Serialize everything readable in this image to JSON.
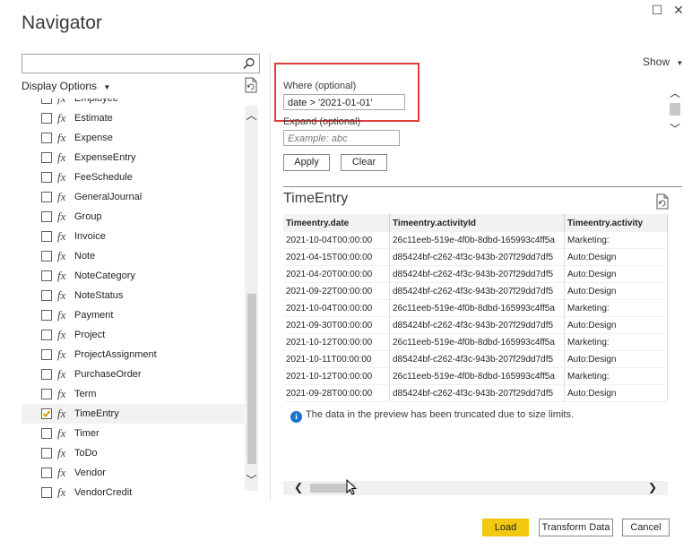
{
  "window": {
    "title": "Navigator",
    "restore_glyph": "☐",
    "close_glyph": "✕"
  },
  "left": {
    "search": {
      "value": "",
      "placeholder": "",
      "icon": "search-icon"
    },
    "display_options_label": "Display Options",
    "items": [
      {
        "label": "Employee",
        "checked": false,
        "selected": false
      },
      {
        "label": "Estimate",
        "checked": false,
        "selected": false
      },
      {
        "label": "Expense",
        "checked": false,
        "selected": false
      },
      {
        "label": "ExpenseEntry",
        "checked": false,
        "selected": false
      },
      {
        "label": "FeeSchedule",
        "checked": false,
        "selected": false
      },
      {
        "label": "GeneralJournal",
        "checked": false,
        "selected": false
      },
      {
        "label": "Group",
        "checked": false,
        "selected": false
      },
      {
        "label": "Invoice",
        "checked": false,
        "selected": false
      },
      {
        "label": "Note",
        "checked": false,
        "selected": false
      },
      {
        "label": "NoteCategory",
        "checked": false,
        "selected": false
      },
      {
        "label": "NoteStatus",
        "checked": false,
        "selected": false
      },
      {
        "label": "Payment",
        "checked": false,
        "selected": false
      },
      {
        "label": "Project",
        "checked": false,
        "selected": false
      },
      {
        "label": "ProjectAssignment",
        "checked": false,
        "selected": false
      },
      {
        "label": "PurchaseOrder",
        "checked": false,
        "selected": false
      },
      {
        "label": "Term",
        "checked": false,
        "selected": false
      },
      {
        "label": "TimeEntry",
        "checked": true,
        "selected": true
      },
      {
        "label": "Timer",
        "checked": false,
        "selected": false
      },
      {
        "label": "ToDo",
        "checked": false,
        "selected": false
      },
      {
        "label": "Vendor",
        "checked": false,
        "selected": false
      },
      {
        "label": "VendorCredit",
        "checked": false,
        "selected": false
      }
    ]
  },
  "right": {
    "show_label": "Show",
    "where": {
      "label": "Where (optional)",
      "value": "date > '2021-01-01'"
    },
    "expand": {
      "label": "Expand (optional)",
      "placeholder": "Example: abc"
    },
    "apply_label": "Apply",
    "clear_label": "Clear",
    "table_name": "TimeEntry",
    "columns": [
      "Timeentry.date",
      "Timeentry.activityId",
      "Timeentry.activity"
    ],
    "rows": [
      [
        "2021-10-04T00:00:00",
        "26c11eeb-519e-4f0b-8dbd-165993c4ff5a",
        "Marketing:"
      ],
      [
        "2021-04-15T00:00:00",
        "d85424bf-c262-4f3c-943b-207f29dd7df5",
        "Auto:Design"
      ],
      [
        "2021-04-20T00:00:00",
        "d85424bf-c262-4f3c-943b-207f29dd7df5",
        "Auto:Design"
      ],
      [
        "2021-09-22T00:00:00",
        "d85424bf-c262-4f3c-943b-207f29dd7df5",
        "Auto:Design"
      ],
      [
        "2021-10-04T00:00:00",
        "26c11eeb-519e-4f0b-8dbd-165993c4ff5a",
        "Marketing:"
      ],
      [
        "2021-09-30T00:00:00",
        "d85424bf-c262-4f3c-943b-207f29dd7df5",
        "Auto:Design"
      ],
      [
        "2021-10-12T00:00:00",
        "26c11eeb-519e-4f0b-8dbd-165993c4ff5a",
        "Marketing:"
      ],
      [
        "2021-10-11T00:00:00",
        "d85424bf-c262-4f3c-943b-207f29dd7df5",
        "Auto:Design"
      ],
      [
        "2021-10-12T00:00:00",
        "26c11eeb-519e-4f0b-8dbd-165993c4ff5a",
        "Marketing:"
      ],
      [
        "2021-09-28T00:00:00",
        "d85424bf-c262-4f3c-943b-207f29dd7df5",
        "Auto:Design"
      ]
    ],
    "info_text": "The data in the preview has been truncated due to size limits."
  },
  "footer": {
    "load_label": "Load",
    "transform_label": "Transform Data",
    "cancel_label": "Cancel"
  },
  "colors": {
    "primary_button": "#f2c811",
    "highlight_border": "#e03c3c",
    "info_icon": "#1a73c9",
    "check_mark": "#d4a000"
  }
}
